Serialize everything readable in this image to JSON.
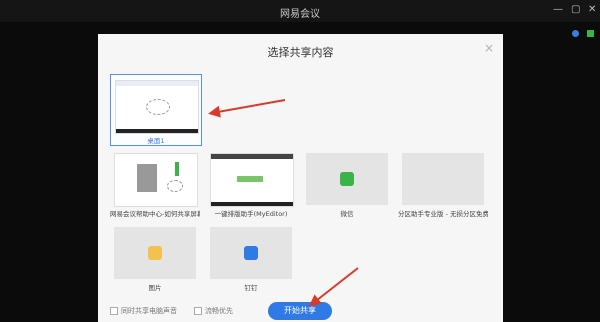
{
  "window": {
    "title": "网易会议"
  },
  "dialog": {
    "title": "选择共享内容",
    "close_glyph": "×",
    "tiles": [
      {
        "label": "桌面1",
        "selected": true
      },
      {
        "label": "网易会议帮助中心-如何共享屏幕"
      },
      {
        "label": "一键排版助手(MyEditor)"
      },
      {
        "label": "微信"
      },
      {
        "label": "分区助手专业版 - 无损分区免费..."
      },
      {
        "label": "图片"
      },
      {
        "label": "钉钉"
      }
    ],
    "footer": {
      "share_audio": "同时共享电脑声音",
      "smooth_first": "流畅优先",
      "start_button": "开始共享"
    }
  },
  "colors": {
    "accent": "#2f7ae6",
    "arrow": "#d93a2b"
  },
  "icons": {
    "minimize": "minimize-icon",
    "restore": "restore-icon",
    "close": "close-icon"
  }
}
